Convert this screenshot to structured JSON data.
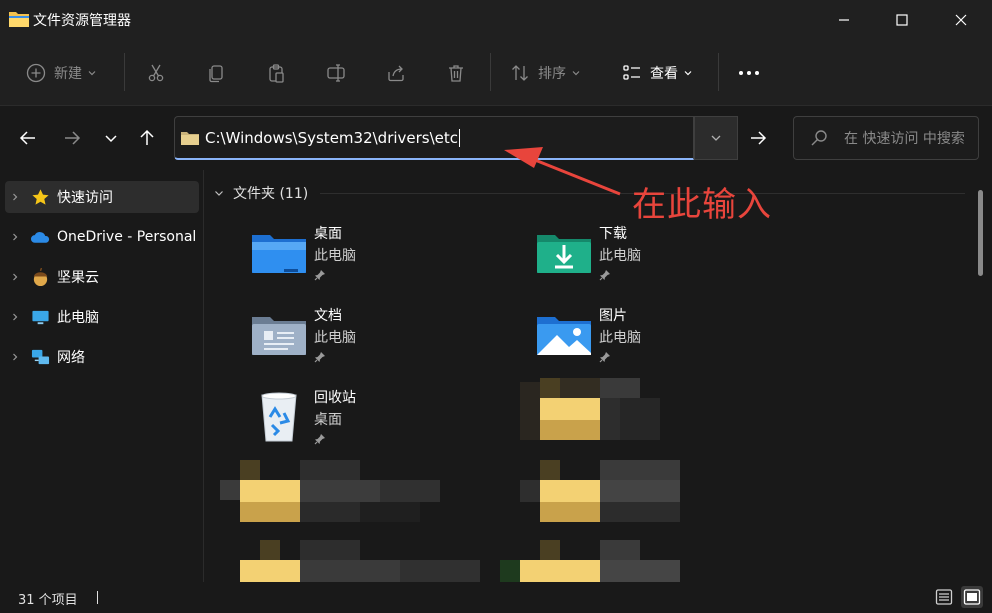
{
  "window": {
    "title": "文件资源管理器"
  },
  "toolbar": {
    "new_label": "新建",
    "sort_label": "排序",
    "view_label": "查看"
  },
  "address": {
    "path": "C:\\Windows\\System32\\drivers\\etc"
  },
  "search": {
    "placeholder": "在 快速访问 中搜索"
  },
  "sidebar": {
    "items": [
      {
        "label": "快速访问",
        "icon": "star-icon"
      },
      {
        "label": "OneDrive - Personal",
        "icon": "cloud-icon"
      },
      {
        "label": "坚果云",
        "icon": "nut-icon"
      },
      {
        "label": "此电脑",
        "icon": "monitor-icon"
      },
      {
        "label": "网络",
        "icon": "network-icon"
      }
    ]
  },
  "main": {
    "group_header": "文件夹 (11)",
    "tiles": [
      {
        "name": "桌面",
        "sub": "此电脑",
        "icon": "desktop-folder-icon"
      },
      {
        "name": "下载",
        "sub": "此电脑",
        "icon": "downloads-folder-icon"
      },
      {
        "name": "文档",
        "sub": "此电脑",
        "icon": "documents-folder-icon"
      },
      {
        "name": "图片",
        "sub": "此电脑",
        "icon": "pictures-folder-icon"
      },
      {
        "name": "回收站",
        "sub": "桌面",
        "icon": "recycle-bin-icon"
      }
    ]
  },
  "status": {
    "count": "31 个项目"
  },
  "annotation": {
    "text": "在此输入",
    "color": "#e8453c"
  },
  "colors": {
    "accent": "#8ab4f8",
    "background": "#191919",
    "chrome": "#202020"
  }
}
